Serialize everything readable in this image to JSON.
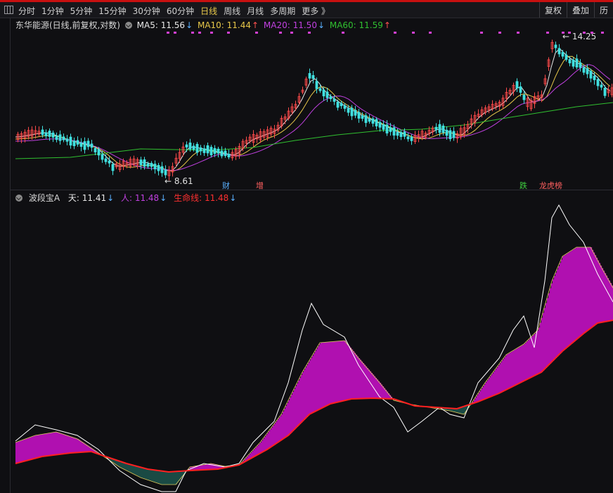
{
  "toolbar": {
    "periods": [
      "分时",
      "1分钟",
      "5分钟",
      "15分钟",
      "30分钟",
      "60分钟",
      "日线",
      "周线",
      "月线",
      "多周期",
      "更多 》"
    ],
    "active_period": "日线",
    "right_buttons": [
      "复权",
      "叠加",
      "历"
    ]
  },
  "main": {
    "stock_label": "东华能源(日线,前复权,对数)",
    "ma": [
      {
        "label": "MA5: 11.56",
        "color": "#e8e8e8",
        "dir": "down"
      },
      {
        "label": "MA10: 11.44",
        "color": "#e8c84a",
        "dir": "up"
      },
      {
        "label": "MA20: 11.50",
        "color": "#c040e0",
        "dir": "down"
      },
      {
        "label": "MA60: 11.59",
        "color": "#30c030",
        "dir": "up"
      }
    ],
    "high_label": "14.25",
    "low_label": "8.61",
    "badges": [
      {
        "text": "财",
        "color": "#5ab0ff"
      },
      {
        "text": "增",
        "color": "#ff6060"
      },
      {
        "text": "跌",
        "color": "#40d040"
      },
      {
        "text": "龙虎榜",
        "color": "#ff6060"
      }
    ]
  },
  "indicator": {
    "name": "波段宝A",
    "fields": [
      {
        "label": "天: 11.41",
        "color": "#e8e8e8",
        "dir": "down"
      },
      {
        "label": "人: 11.48",
        "color": "#c040e0",
        "dir": "down"
      },
      {
        "label": "生命线: 11.48",
        "color": "#ff3030",
        "dir": "down"
      }
    ]
  },
  "colors": {
    "up": "#ff4a4a",
    "down": "#40e0e0",
    "fill_up": "#b010b0",
    "fill_down": "#1a4a44",
    "lifeline": "#ff2020"
  }
}
